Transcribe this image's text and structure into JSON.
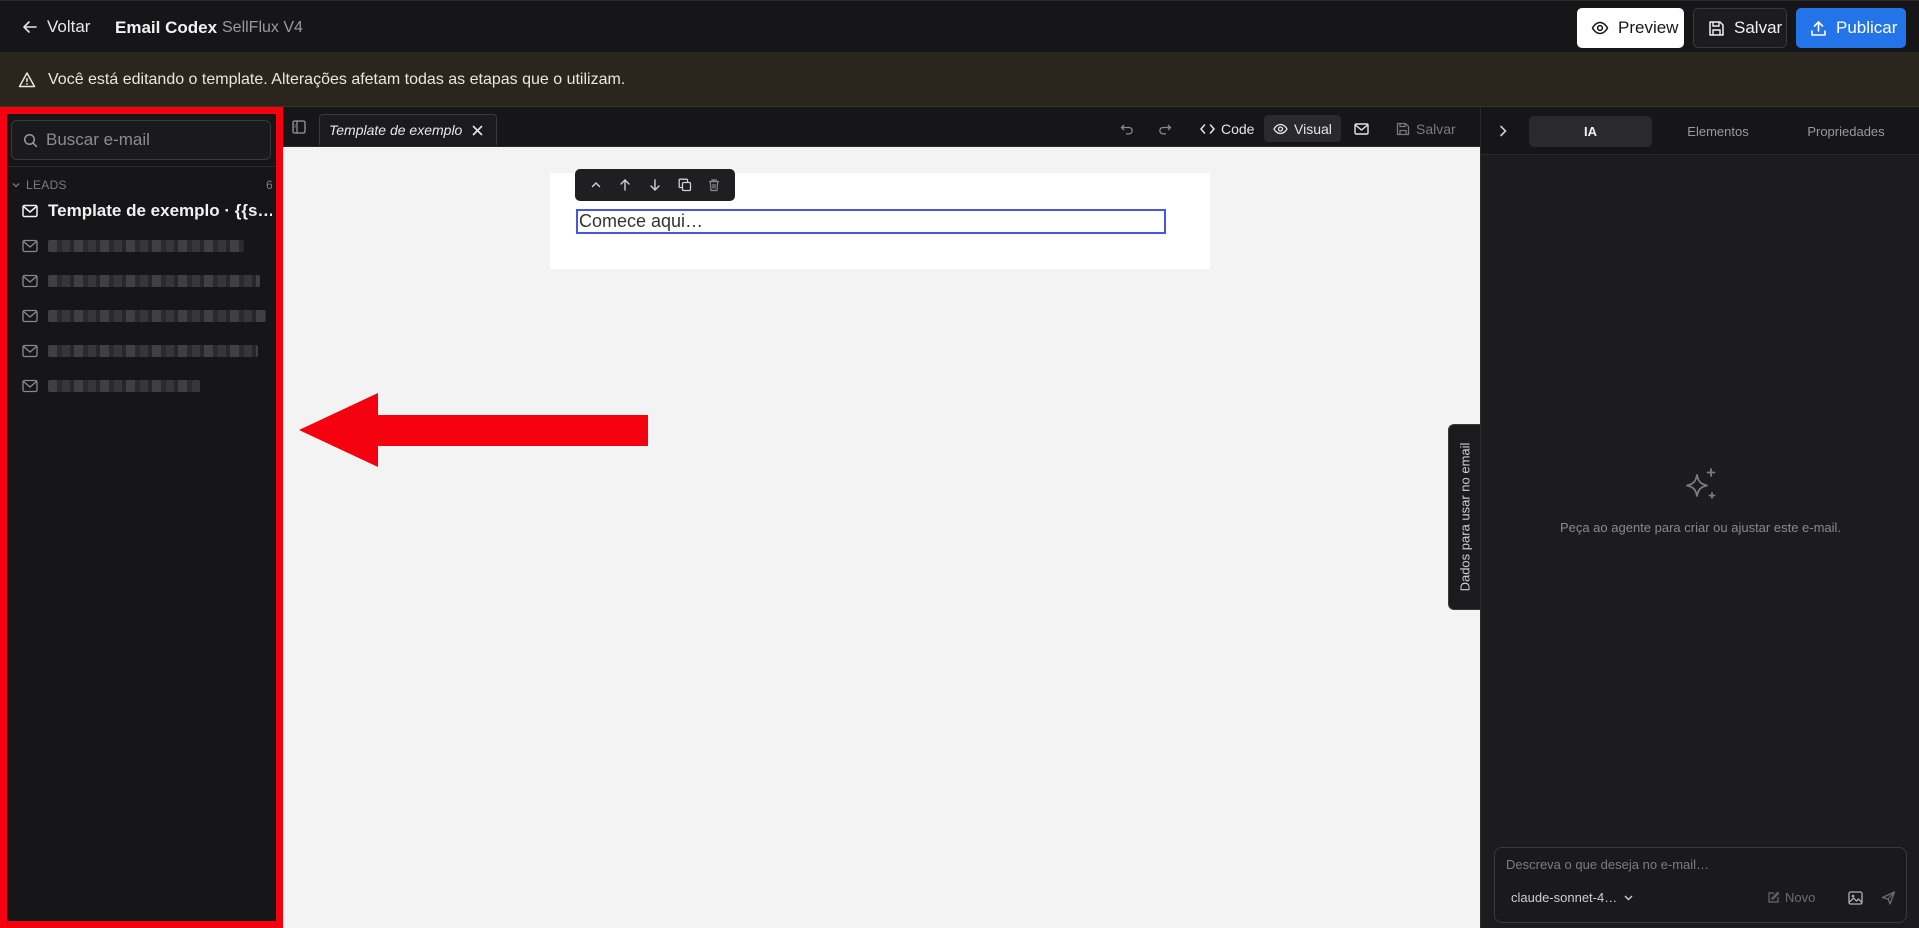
{
  "header": {
    "back_label": "Voltar",
    "app_title": "Email Codex",
    "app_subtitle": "SellFlux V4",
    "preview_label": "Preview",
    "save_label": "Salvar",
    "publish_label": "Publicar"
  },
  "banner": {
    "text": "Você está editando o template. Alterações afetam todas as etapas que o utilizam."
  },
  "sidebar": {
    "search_placeholder": "Buscar e-mail",
    "group": {
      "label": "LEADS",
      "count": "6"
    },
    "items": [
      {
        "label": "Template de exemplo · {{s…",
        "blurred": false
      },
      {
        "label": "",
        "blurred": true
      },
      {
        "label": "",
        "blurred": true
      },
      {
        "label": "",
        "blurred": true
      },
      {
        "label": "",
        "blurred": true
      },
      {
        "label": "",
        "blurred": true
      }
    ]
  },
  "editor": {
    "tab_label": "Template de exemplo",
    "code_label": "Code",
    "visual_label": "Visual",
    "save_label": "Salvar",
    "block_text": "Comece aqui…",
    "side_tab_label": "Dados para usar no email"
  },
  "right_panel": {
    "tabs": [
      "IA",
      "Elementos",
      "Propriedades"
    ],
    "active_tab": "IA",
    "empty_message": "Peça ao agente para criar ou ajustar este e-mail.",
    "prompt_placeholder": "Descreva o que deseja no e-mail…",
    "model_label": "claude-sonnet-4…",
    "new_label": "Novo"
  },
  "colors": {
    "accent": "#2374e8",
    "highlight_border": "#f4000f",
    "selection": "#4756e6"
  }
}
